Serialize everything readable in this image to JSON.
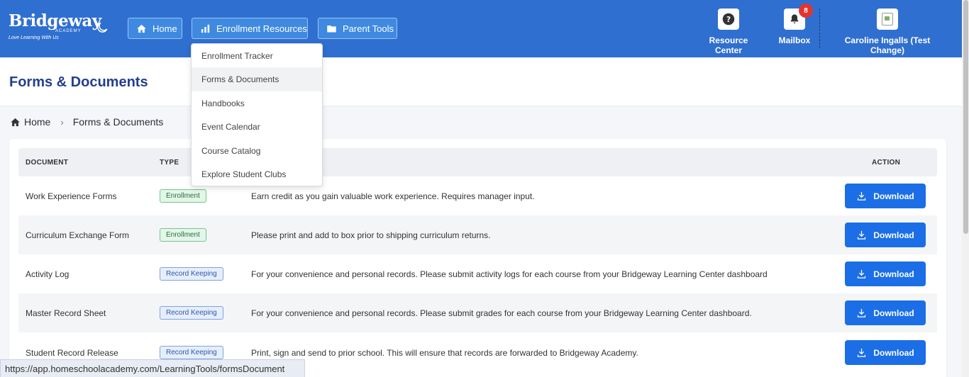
{
  "header": {
    "logo": {
      "brand": "Bridgeway",
      "sub": "ACADEMY",
      "tagline": "Love Learning With Us"
    },
    "nav": [
      {
        "label": "Home",
        "icon": "home-icon"
      },
      {
        "label": "Enrollment Resources",
        "icon": "bar-chart-icon"
      },
      {
        "label": "Parent Tools",
        "icon": "folder-icon"
      }
    ],
    "resource_center": "Resource Center",
    "mailbox": {
      "label": "Mailbox",
      "count": "8"
    },
    "user": "Caroline Ingalls (Test Change)",
    "colors": {
      "bar": "#2f6fd0",
      "badge": "#e3342f"
    }
  },
  "page": {
    "title": "Forms & Documents"
  },
  "breadcrumb": {
    "home": "Home",
    "current": "Forms & Documents"
  },
  "dropdown": {
    "items": [
      "Enrollment Tracker",
      "Forms & Documents",
      "Handbooks",
      "Event Calendar",
      "Course Catalog",
      "Explore Student Clubs"
    ],
    "active_index": 1
  },
  "table": {
    "headers": {
      "document": "DOCUMENT",
      "type": "TYPE",
      "action": "ACTION"
    },
    "download_label": "Download",
    "rows": [
      {
        "document": "Work Experience Forms",
        "type": "Enrollment",
        "description": "Earn credit as you gain valuable work experience. Requires manager input."
      },
      {
        "document": "Curriculum Exchange Form",
        "type": "Enrollment",
        "description": "Please print and add to box prior to shipping curriculum returns."
      },
      {
        "document": "Activity Log",
        "type": "Record Keeping",
        "description": "For your convenience and personal records. Please submit activity logs for each course from your Bridgeway Learning Center dashboard"
      },
      {
        "document": "Master Record Sheet",
        "type": "Record Keeping",
        "description": "For your convenience and personal records. Please submit grades for each course from your Bridgeway Learning Center dashboard."
      },
      {
        "document": "Student Record Release",
        "type": "Record Keeping",
        "description": "Print, sign and send to prior school. This will ensure that records are forwarded to Bridgeway Academy."
      }
    ]
  },
  "status_url": "https://app.homeschoolacademy.com/LearningTools/formsDocument"
}
